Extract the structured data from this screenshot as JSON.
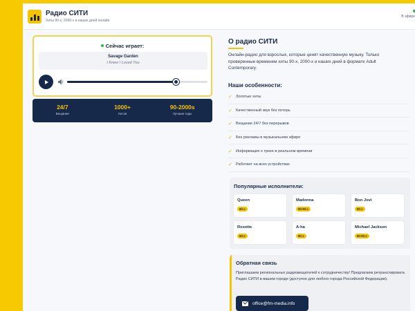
{
  "header": {
    "title": "Радио СИТИ",
    "subtitle": "Хиты 90-х, 2000-х и наших дней онлайн",
    "status": "В эфире"
  },
  "player": {
    "now_playing_label": "Сейчас играет:",
    "artist": "Savage Garden",
    "song": "I Knew I Loved You",
    "volume_level": 0.78,
    "icons": {
      "play": "play-icon",
      "volume": "volume-icon"
    }
  },
  "stats": [
    {
      "value": "24/7",
      "label": "Вещание"
    },
    {
      "value": "1000+",
      "label": "Хитов"
    },
    {
      "value": "90-2000s",
      "label": "Лучшие годы"
    }
  ],
  "about": {
    "title": "О радио СИТИ",
    "text": "Онлайн-радио для взрослых, которые ценят качественную музыку. Только проверенные временем хиты 90-х, 2000-х и наших дней в формате Adult Contemporary."
  },
  "features": {
    "title": "Наши особенности:",
    "items": [
      "Золотые хиты",
      "Качественный звук без потерь",
      "Вещание 24/7 без перерывов",
      "Без рекламы в музыкальном эфире",
      "Информация о треке в реальном времени",
      "Работает на всех устройствах"
    ]
  },
  "artists": {
    "title": "Популярные исполнители:",
    "items": [
      {
        "name": "Queen",
        "era": "80-х"
      },
      {
        "name": "Madonna",
        "era": "80-90-х"
      },
      {
        "name": "Bon Jovi",
        "era": "90-х"
      },
      {
        "name": "Roxette",
        "era": "90-х"
      },
      {
        "name": "A-ha",
        "era": "80-х"
      },
      {
        "name": "Michael Jackson",
        "era": "80-90-х"
      }
    ]
  },
  "feedback": {
    "title": "Обратная связь",
    "text": "Приглашаем региональных радиовещателей к сотрудничеству! Предлагаем ретранслировать Радио СИТИ в вашем городе (доступно для любого города Российской Федерации).",
    "email": "office@fm-media.info"
  },
  "colors": {
    "accent": "#f5c300",
    "dark": "#17294a",
    "live": "#2fb24c"
  }
}
